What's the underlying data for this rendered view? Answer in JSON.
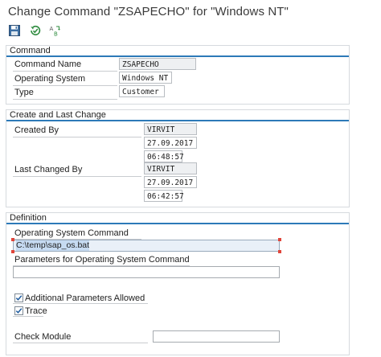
{
  "window": {
    "title": "Change Command \"ZSAPECHO\" for \"Windows NT\""
  },
  "toolbar": {
    "buttons": [
      {
        "name": "save",
        "icon": "save-icon"
      },
      {
        "name": "check",
        "icon": "check-icon"
      },
      {
        "name": "other-object",
        "icon": "display-change-icon"
      }
    ]
  },
  "command_group": {
    "header": "Command",
    "fields": {
      "command_name": {
        "label": "Command Name",
        "value": "ZSAPECHO"
      },
      "operating_system": {
        "label": "Operating System",
        "value": "Windows NT"
      },
      "type": {
        "label": "Type",
        "value": "Customer"
      }
    }
  },
  "change_group": {
    "header": "Create and Last Change",
    "created_by": {
      "label": "Created By",
      "user": "VIRVIT",
      "date": "27.09.2017",
      "time": "06:48:57"
    },
    "last_changed_by": {
      "label": "Last Changed By",
      "user": "VIRVIT",
      "date": "27.09.2017",
      "time": "06:42:57"
    }
  },
  "definition_group": {
    "header": "Definition",
    "os_command": {
      "label": "Operating System Command",
      "value": "C:\\temp\\sap_os.bat"
    },
    "parameters": {
      "label": "Parameters for Operating System Command",
      "value": ""
    },
    "additional_params": {
      "label": "Additional Parameters Allowed",
      "checked": true
    },
    "trace": {
      "label": "Trace",
      "checked": true
    },
    "check_module": {
      "label": "Check Module",
      "value": ""
    }
  },
  "colors": {
    "accent": "#2d7ab8",
    "header_text": "#3a3a3a",
    "highlight": "#c6dbf2"
  }
}
